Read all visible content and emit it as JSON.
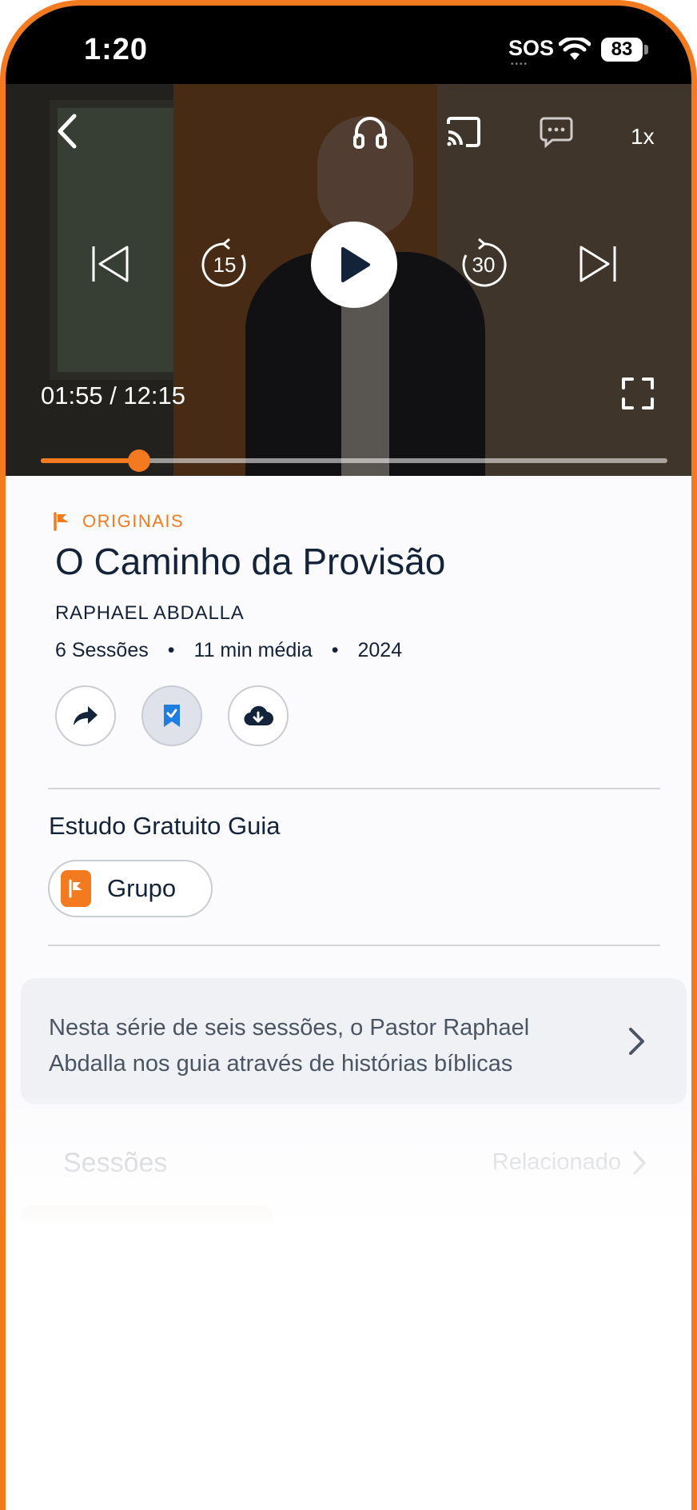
{
  "status_bar": {
    "time": "1:20",
    "sos": "SOS",
    "battery": "83"
  },
  "player": {
    "speed": "1x",
    "time_readout": "01:55 / 12:15",
    "progress_fraction": 0.157,
    "icons": [
      "back-icon",
      "headphones-icon",
      "cast-icon",
      "chat-icon",
      "skip-previous-icon",
      "rewind-15-icon",
      "play-icon",
      "forward-30-icon",
      "skip-next-icon",
      "fullscreen-icon"
    ],
    "rewind_label": "15",
    "forward_label": "30"
  },
  "series": {
    "brand": "ORIGINAIS",
    "title": "O Caminho da Provisão",
    "author": "RAPHAEL ABDALLA",
    "meta": {
      "sessions": "6 Sessões",
      "duration": "11 min média",
      "year": "2024"
    }
  },
  "guide": {
    "title": "Estudo Gratuito Guia",
    "chip_label": "Grupo"
  },
  "description": "Nesta série de seis sessões, o Pastor Raphael Abdalla nos guia através de histórias bíblicas",
  "tabs": {
    "sessions": "Sessões",
    "related": "Relacionado"
  },
  "colors": {
    "accent": "#f47a20",
    "text": "#13233a"
  }
}
